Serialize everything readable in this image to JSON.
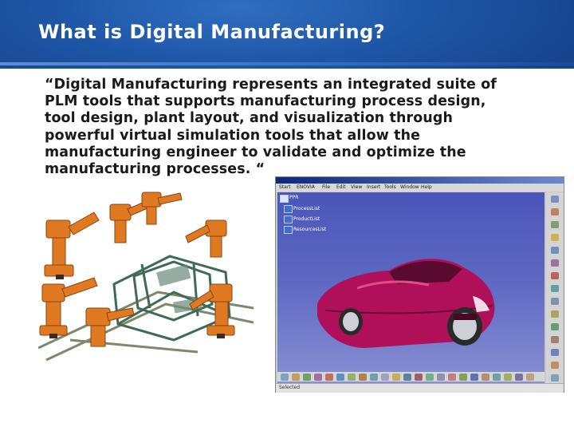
{
  "slide": {
    "title": "What is Digital Manufacturing?",
    "body_lines": [
      "“Digital Manufacturing represents an integrated suite of",
      "PLM tools that supports manufacturing process design,",
      "tool design, plant layout, and visualization through",
      "powerful virtual simulation tools that allow the",
      "manufacturing engineer to validate and optimize the",
      "manufacturing processes. “"
    ]
  },
  "colors": {
    "banner": "#1e56a6",
    "title_text": "#ffffff",
    "robot_orange": "#e07a22",
    "car_magenta": "#b0105a",
    "viewport_blue": "#5e68c2"
  },
  "cad_window": {
    "menu": [
      "Start",
      "ENOVIA",
      "File",
      "Edit",
      "View",
      "Insert",
      "Tools",
      "Window",
      "Help"
    ],
    "tree": {
      "root": "PPR",
      "children": [
        "ProcessList",
        "ProductList",
        "ResourcesList"
      ]
    },
    "status": "Selected"
  },
  "images": {
    "robot_line": "robot-assembly-line-illustration",
    "car_model": "3d-car-model"
  }
}
